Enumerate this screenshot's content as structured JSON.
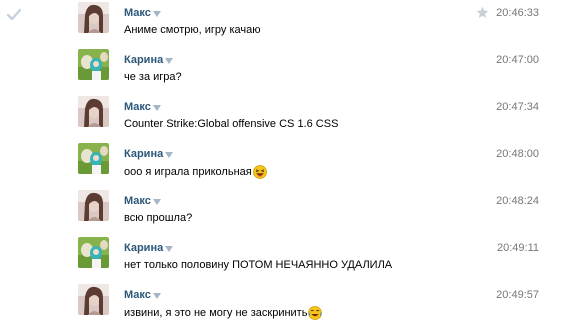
{
  "messages": [
    {
      "author": "Макс",
      "time": "20:46:33",
      "text": "Аниме смотрю, игру качаю",
      "emoji": "",
      "avatar": "maks-avatar",
      "starred": true
    },
    {
      "author": "Карина",
      "time": "20:47:00",
      "text": "че за игра?",
      "emoji": "",
      "avatar": "karina-avatar",
      "starred": false
    },
    {
      "author": "Макс",
      "time": "20:47:34",
      "text": "Counter Strike:Global offensive CS 1.6 CSS",
      "emoji": "",
      "avatar": "maks-avatar",
      "starred": false
    },
    {
      "author": "Карина",
      "time": "20:48:00",
      "text": "ооо я играла прикольная",
      "emoji": "laughing-emoji",
      "avatar": "karina-avatar",
      "starred": false
    },
    {
      "author": "Макс",
      "time": "20:48:24",
      "text": "всю прошла?",
      "emoji": "",
      "avatar": "maks-avatar",
      "starred": false
    },
    {
      "author": "Карина",
      "time": "20:49:11",
      "text": "нет только половину ПОТОМ НЕЧАЯННО УДАЛИЛА",
      "emoji": "",
      "avatar": "karina-avatar",
      "starred": false
    },
    {
      "author": "Макс",
      "time": "20:49:57",
      "text": "извини, я это не могу не заскринить",
      "emoji": "tears-of-joy-emoji",
      "avatar": "maks-avatar",
      "starred": false
    }
  ],
  "colors": {
    "author": "#2b587a",
    "time": "#777777",
    "text": "#000000"
  }
}
